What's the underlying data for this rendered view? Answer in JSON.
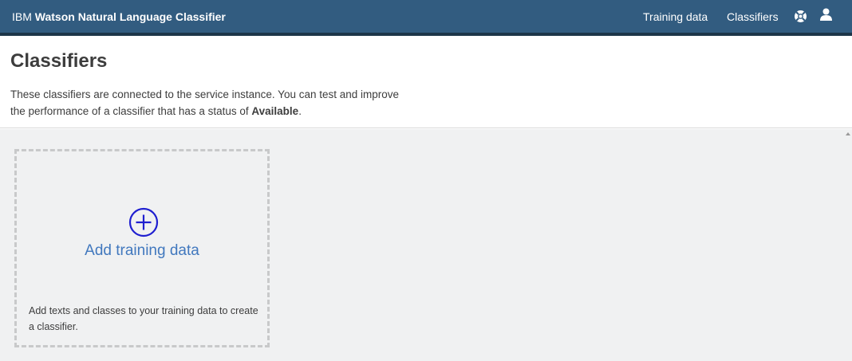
{
  "topbar": {
    "brand_prefix": "IBM",
    "brand_product": "Watson Natural Language Classifier",
    "nav": {
      "training_data": "Training data",
      "classifiers": "Classifiers"
    },
    "icons": [
      "help-icon",
      "user-icon"
    ],
    "colors": {
      "background": "#325c80",
      "border": "#1d3649"
    }
  },
  "page": {
    "title": "Classifiers",
    "description_part1": "These classifiers are connected to the service instance. You can test and improve the performance of a classifier that has a status of ",
    "description_bold": "Available",
    "description_end": "."
  },
  "add_tile": {
    "icon": "plus-circle-icon",
    "title": "Add training data",
    "description": "Add texts and classes to your training data to create a classifier.",
    "colors": {
      "title": "#4178be",
      "icon": "#1f1fd0"
    }
  }
}
